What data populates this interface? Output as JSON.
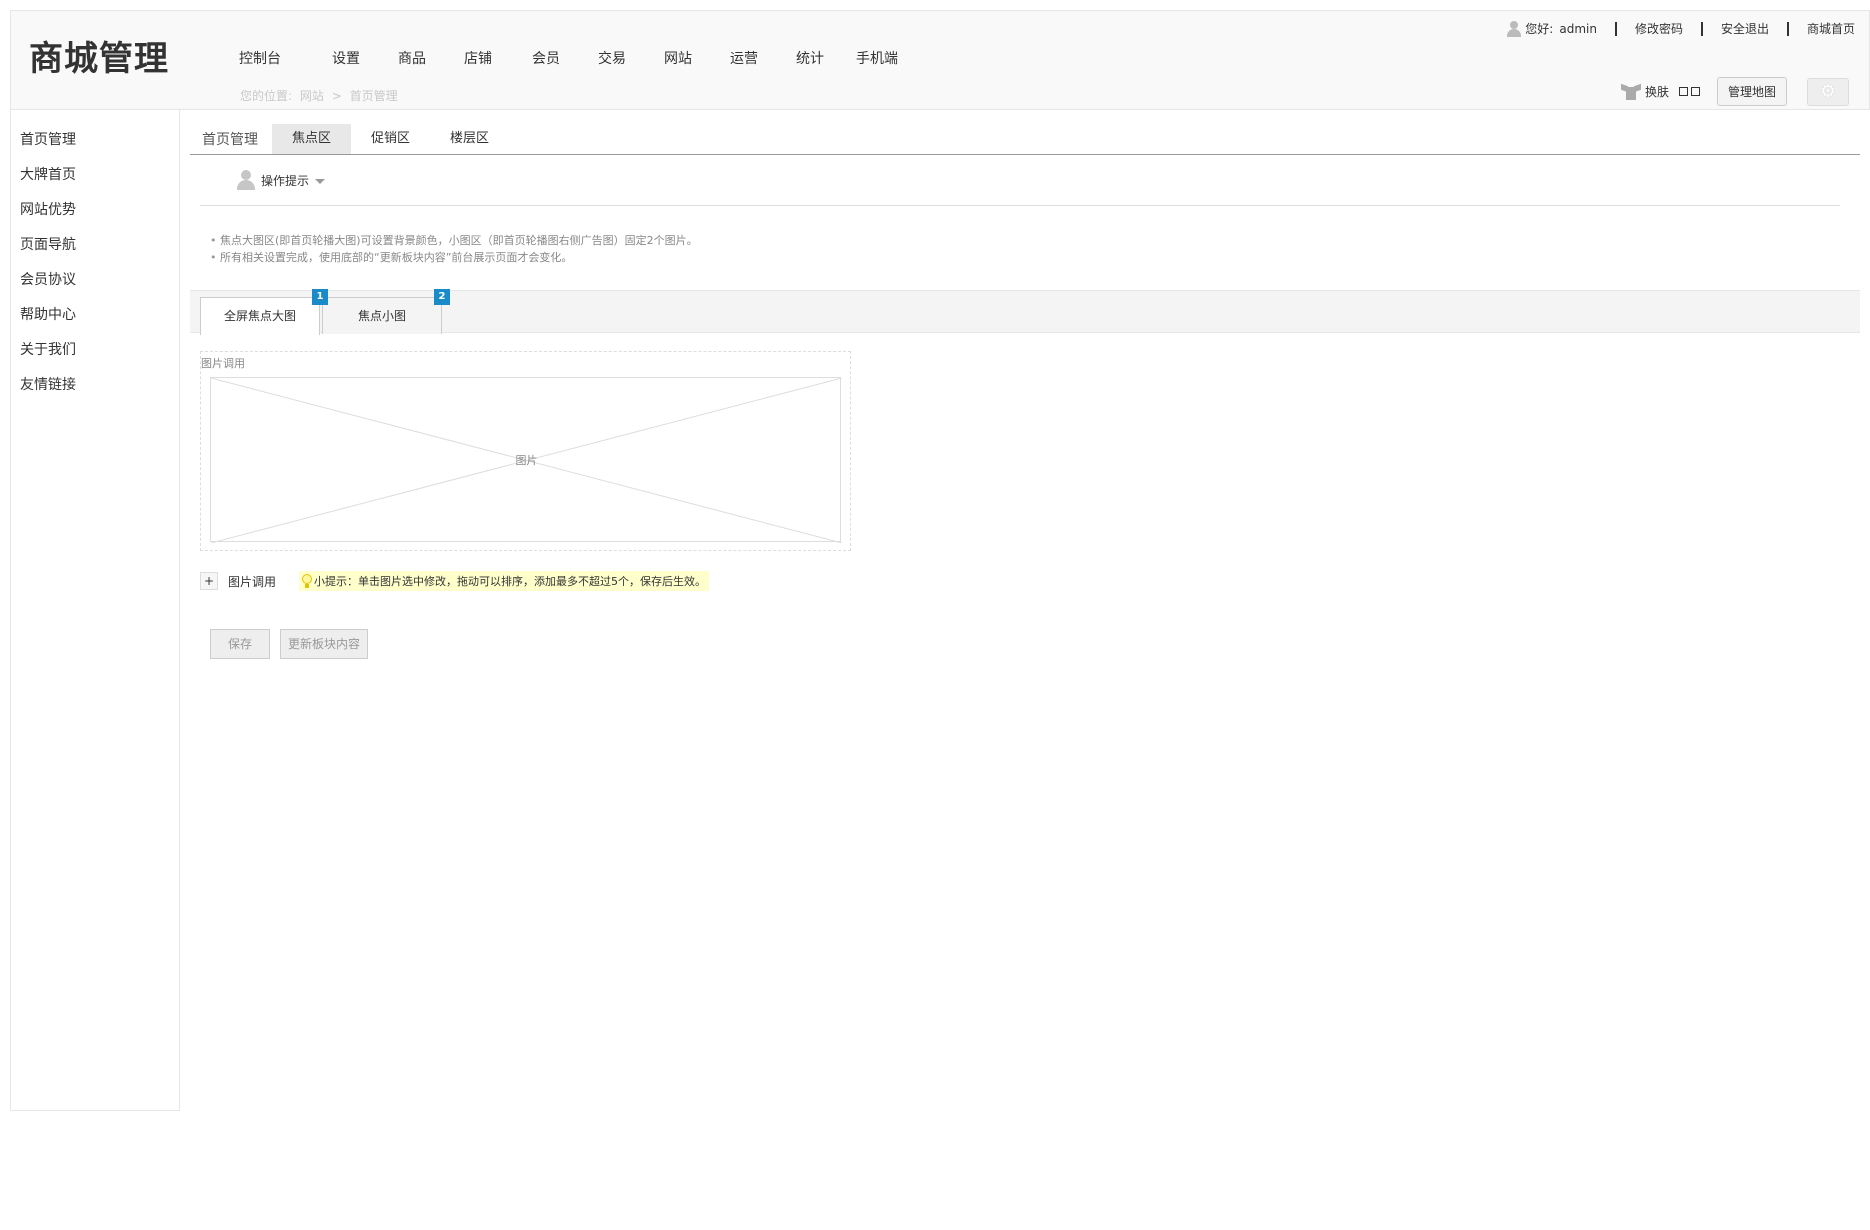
{
  "header": {
    "logo": "商城管理",
    "nav": [
      "控制台",
      "设置",
      "商品",
      "店铺",
      "会员",
      "交易",
      "网站",
      "运营",
      "统计",
      "手机端"
    ],
    "breadcrumb": {
      "prefix": "您的位置:",
      "section": "网站",
      "sep": ">",
      "page": "首页管理"
    },
    "user": {
      "greeting": "您好:",
      "name": "admin"
    },
    "links": {
      "change_password": "修改密码",
      "logout": "安全退出",
      "mall_home": "商城首页"
    },
    "skin_label": "换肤",
    "map_button": "管理地图"
  },
  "sidebar": {
    "items": [
      "首页管理",
      "大牌首页",
      "网站优势",
      "页面导航",
      "会员协议",
      "帮助中心",
      "关于我们",
      "友情链接"
    ]
  },
  "main": {
    "section_title": "首页管理",
    "tabs": [
      "焦点区",
      "促销区",
      "楼层区"
    ],
    "active_tab": "焦点区",
    "tips_title": "操作提示",
    "tips": [
      "焦点大图区(即首页轮播大图)可设置背景颜色，小图区（即首页轮播图右侧广告图）固定2个图片。",
      "所有相关设置完成，使用底部的“更新板块内容”前台展示页面才会变化。"
    ],
    "focus_tabs": [
      {
        "label": "全屏焦点大图",
        "badge": "1"
      },
      {
        "label": "焦点小图",
        "badge": "2"
      }
    ],
    "slot_label": "图片调用",
    "placeholder_text": "图片",
    "add": {
      "plus": "+",
      "label": "图片调用"
    },
    "hint": "小提示：单击图片选中修改，拖动可以排序，添加最多不超过5个，保存后生效。",
    "buttons": {
      "save": "保存",
      "update": "更新板块内容"
    }
  },
  "icons": [
    "user-icon",
    "shirt-icon",
    "gear-icon",
    "caret-down-icon",
    "bulb-icon"
  ],
  "colors": {
    "accent": "#1a8bc9",
    "hint_bg": "#ffffcc"
  }
}
